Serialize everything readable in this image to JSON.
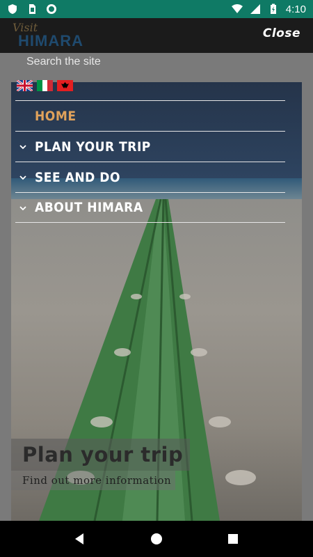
{
  "status_bar": {
    "time": "4:10",
    "icons": [
      "shield-icon",
      "sim-card-icon",
      "circle-record-icon",
      "wifi-icon",
      "signal-icon",
      "battery-charging-icon"
    ]
  },
  "header": {
    "logo_visit": "Visit",
    "logo_name": "HIMARA",
    "close_label": "Close"
  },
  "search": {
    "placeholder": "Search the site"
  },
  "languages": [
    "english-flag",
    "italian-flag",
    "albanian-flag"
  ],
  "menu": {
    "items": [
      {
        "label": "HOME",
        "active": true,
        "expandable": false
      },
      {
        "label": "PLAN YOUR TRIP",
        "active": false,
        "expandable": true
      },
      {
        "label": "SEE AND DO",
        "active": false,
        "expandable": true
      },
      {
        "label": "ABOUT HIMARA",
        "active": false,
        "expandable": true
      }
    ]
  },
  "promo": {
    "title": "Plan your trip",
    "subtitle": "Find out more information"
  },
  "colors": {
    "status_bar": "#0f7a65",
    "accent": "#e0a25b",
    "menu_text": "#ffffff"
  },
  "nav_bar": {
    "buttons": [
      "back-icon",
      "home-icon",
      "recents-icon"
    ]
  }
}
